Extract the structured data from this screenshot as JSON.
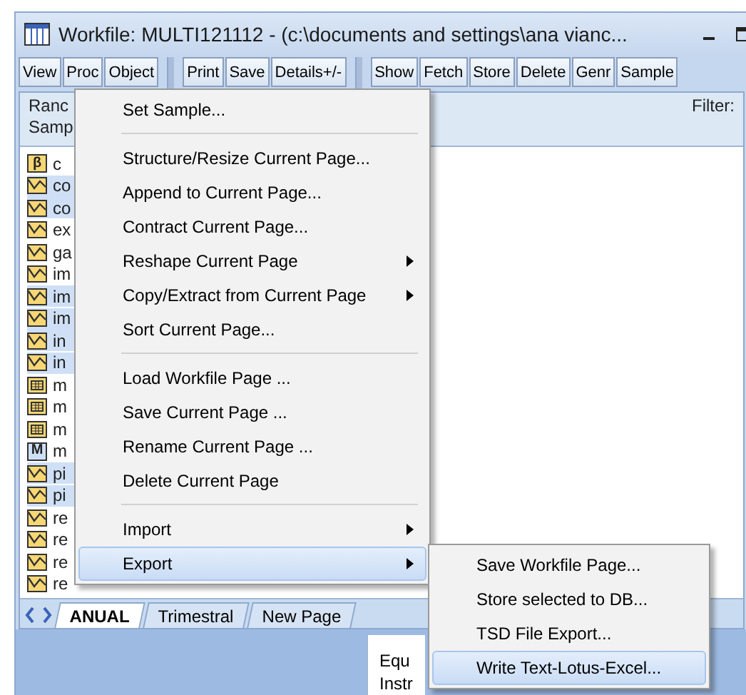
{
  "window": {
    "title": "Workfile: MULTI121112 - (c:\\documents and settings\\ana vianc..."
  },
  "toolbar": [
    [
      "View",
      "Proc",
      "Object"
    ],
    [
      "Print",
      "Save",
      "Details+/-"
    ],
    [
      "Show",
      "Fetch",
      "Store",
      "Delete",
      "Genr",
      "Sample"
    ]
  ],
  "header": {
    "range_label": "Ranc",
    "sample_label": "Samp",
    "filter_label": "Filter:"
  },
  "objects": [
    {
      "kind": "coef",
      "glyph": "β",
      "name": "c",
      "selected": false
    },
    {
      "kind": "series",
      "name": "co",
      "selected": true
    },
    {
      "kind": "series",
      "name": "co",
      "selected": true
    },
    {
      "kind": "series",
      "name": "ex",
      "selected": false
    },
    {
      "kind": "series",
      "name": "ga",
      "selected": false
    },
    {
      "kind": "series",
      "name": "im",
      "selected": false
    },
    {
      "kind": "series",
      "name": "im",
      "selected": true
    },
    {
      "kind": "series",
      "name": "im",
      "selected": true
    },
    {
      "kind": "series",
      "name": "in",
      "selected": true
    },
    {
      "kind": "series",
      "name": "in",
      "selected": true
    },
    {
      "kind": "group",
      "name": "m",
      "selected": false
    },
    {
      "kind": "group",
      "name": "m",
      "selected": false
    },
    {
      "kind": "group",
      "name": "m",
      "selected": false
    },
    {
      "kind": "model",
      "glyph": "M",
      "name": "m",
      "selected": false
    },
    {
      "kind": "series",
      "name": "pi",
      "selected": true
    },
    {
      "kind": "series",
      "name": "pi",
      "selected": true
    },
    {
      "kind": "series",
      "name": "re",
      "selected": false
    },
    {
      "kind": "series",
      "name": "re",
      "selected": false
    },
    {
      "kind": "series",
      "name": "re",
      "selected": false
    },
    {
      "kind": "series",
      "name": "re",
      "selected": false
    }
  ],
  "page_tabs": [
    {
      "label": "ANUAL",
      "selected": true
    },
    {
      "label": "Trimestral",
      "selected": false
    },
    {
      "label": "New Page",
      "selected": false
    }
  ],
  "lower_panel": {
    "lines": [
      "Equ",
      "Instr"
    ]
  },
  "proc_menu": [
    {
      "kind": "item",
      "label": "Set Sample...",
      "submenu": false,
      "selected": false
    },
    {
      "kind": "separator"
    },
    {
      "kind": "item",
      "label": "Structure/Resize Current Page...",
      "submenu": false,
      "selected": false
    },
    {
      "kind": "item",
      "label": "Append to Current Page...",
      "submenu": false,
      "selected": false
    },
    {
      "kind": "item",
      "label": "Contract Current Page...",
      "submenu": false,
      "selected": false
    },
    {
      "kind": "item",
      "label": "Reshape Current Page",
      "submenu": true,
      "selected": false
    },
    {
      "kind": "item",
      "label": "Copy/Extract from Current Page",
      "submenu": true,
      "selected": false
    },
    {
      "kind": "item",
      "label": "Sort Current Page...",
      "submenu": false,
      "selected": false
    },
    {
      "kind": "separator"
    },
    {
      "kind": "item",
      "label": "Load Workfile Page ...",
      "submenu": false,
      "selected": false
    },
    {
      "kind": "item",
      "label": "Save Current Page ...",
      "submenu": false,
      "selected": false
    },
    {
      "kind": "item",
      "label": "Rename Current Page ...",
      "submenu": false,
      "selected": false
    },
    {
      "kind": "item",
      "label": "Delete Current Page",
      "submenu": false,
      "selected": false
    },
    {
      "kind": "separator"
    },
    {
      "kind": "item",
      "label": "Import",
      "submenu": true,
      "selected": false
    },
    {
      "kind": "item",
      "label": "Export",
      "submenu": true,
      "selected": true
    }
  ],
  "export_menu": [
    {
      "kind": "item",
      "label": "Save Workfile Page...",
      "submenu": false,
      "selected": false
    },
    {
      "kind": "item",
      "label": "Store selected to DB...",
      "submenu": false,
      "selected": false
    },
    {
      "kind": "item",
      "label": "TSD File Export...",
      "submenu": false,
      "selected": false
    },
    {
      "kind": "item",
      "label": "Write Text-Lotus-Excel...",
      "submenu": false,
      "selected": true
    }
  ]
}
